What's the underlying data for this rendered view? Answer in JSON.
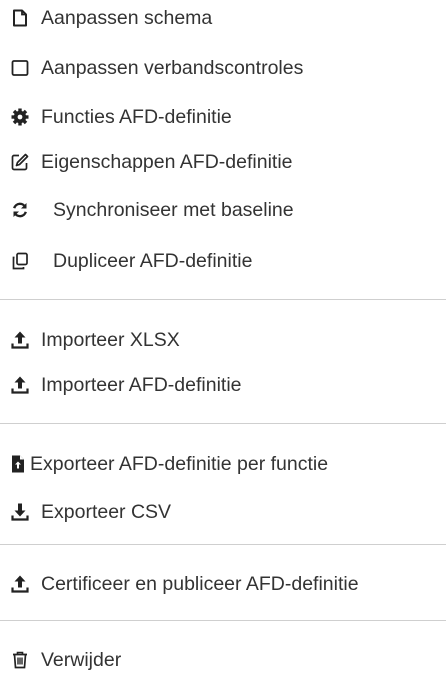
{
  "menu": {
    "items": [
      {
        "label": "Aanpassen schema",
        "icon": "file-icon"
      },
      {
        "label": "Aanpassen verbandscontroles",
        "icon": "square-icon"
      },
      {
        "label": "Functies AFD-definitie",
        "icon": "gear-icon"
      },
      {
        "label": "Eigenschappen AFD-definitie",
        "icon": "edit-icon"
      },
      {
        "label": "Synchroniseer met baseline",
        "icon": "sync-icon"
      },
      {
        "label": "Dupliceer AFD-definitie",
        "icon": "copy-icon"
      },
      {
        "label": "Importeer XLSX",
        "icon": "upload-icon"
      },
      {
        "label": "Importeer AFD-definitie",
        "icon": "upload-icon"
      },
      {
        "label": "Exporteer AFD-definitie per functie",
        "icon": "file-export-icon"
      },
      {
        "label": "Exporteer CSV",
        "icon": "download-icon"
      },
      {
        "label": "Certificeer en publiceer AFD-definitie",
        "icon": "upload-icon"
      },
      {
        "label": "Verwijder",
        "icon": "trash-icon"
      }
    ]
  }
}
